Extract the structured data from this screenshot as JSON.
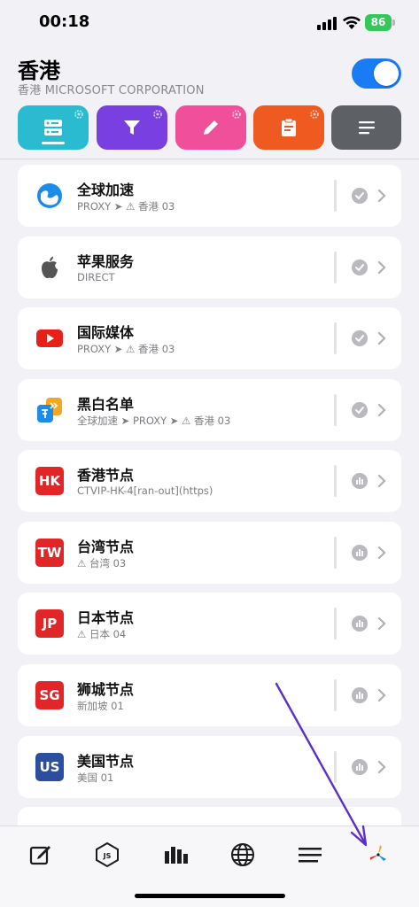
{
  "status_bar": {
    "time": "00:18",
    "battery": "86"
  },
  "header": {
    "title": "香港",
    "subtitle": "香港 MICROSOFT CORPORATION",
    "toggle_on": true
  },
  "tools": [
    {
      "name": "servers",
      "color": "#2bbbd0"
    },
    {
      "name": "filter",
      "color": "#7a3fe0"
    },
    {
      "name": "edit",
      "color": "#f0509a"
    },
    {
      "name": "clipboard",
      "color": "#ee5a1f"
    },
    {
      "name": "list",
      "color": "#5d6166"
    }
  ],
  "policies": [
    {
      "name": "全球加速",
      "sub": "PROXY ➤ ⚠ 香港 03",
      "icon": "globe-icon",
      "status": "check"
    },
    {
      "name": "苹果服务",
      "sub": "DIRECT",
      "icon": "apple-icon",
      "status": "check"
    },
    {
      "name": "国际媒体",
      "sub": "PROXY ➤ ⚠ 香港 03",
      "icon": "youtube-icon",
      "status": "check"
    },
    {
      "name": "黑白名单",
      "sub": "全球加速 ➤ PROXY ➤ ⚠ 香港 03",
      "icon": "translate-icon",
      "status": "check"
    },
    {
      "name": "香港节点",
      "sub": "CTVIP-HK-4[ran-out](https)",
      "icon": "flag-hk-icon",
      "flag": "HK",
      "flag_color": "#e02626",
      "status": "bars"
    },
    {
      "name": "台湾节点",
      "sub": "⚠ 台湾 03",
      "icon": "flag-tw-icon",
      "flag": "TW",
      "flag_color": "#e02626",
      "status": "bars"
    },
    {
      "name": "日本节点",
      "sub": "⚠ 日本 04",
      "icon": "flag-jp-icon",
      "flag": "JP",
      "flag_color": "#e02626",
      "status": "bars"
    },
    {
      "name": "狮城节点",
      "sub": "新加坡 01",
      "icon": "flag-sg-icon",
      "flag": "SG",
      "flag_color": "#e02626",
      "status": "bars"
    },
    {
      "name": "美国节点",
      "sub": "美国 01",
      "icon": "flag-us-icon",
      "flag": "US",
      "flag_color": "#2b4f9e",
      "status": "bars"
    }
  ],
  "tabbar": {
    "items": [
      "edit-icon",
      "js-icon",
      "stats-icon",
      "globe-icon",
      "list-icon",
      "pinwheel-icon"
    ]
  },
  "colors": {
    "accent": "#1a7cf5",
    "annotation_arrow": "#5b2fc9"
  }
}
